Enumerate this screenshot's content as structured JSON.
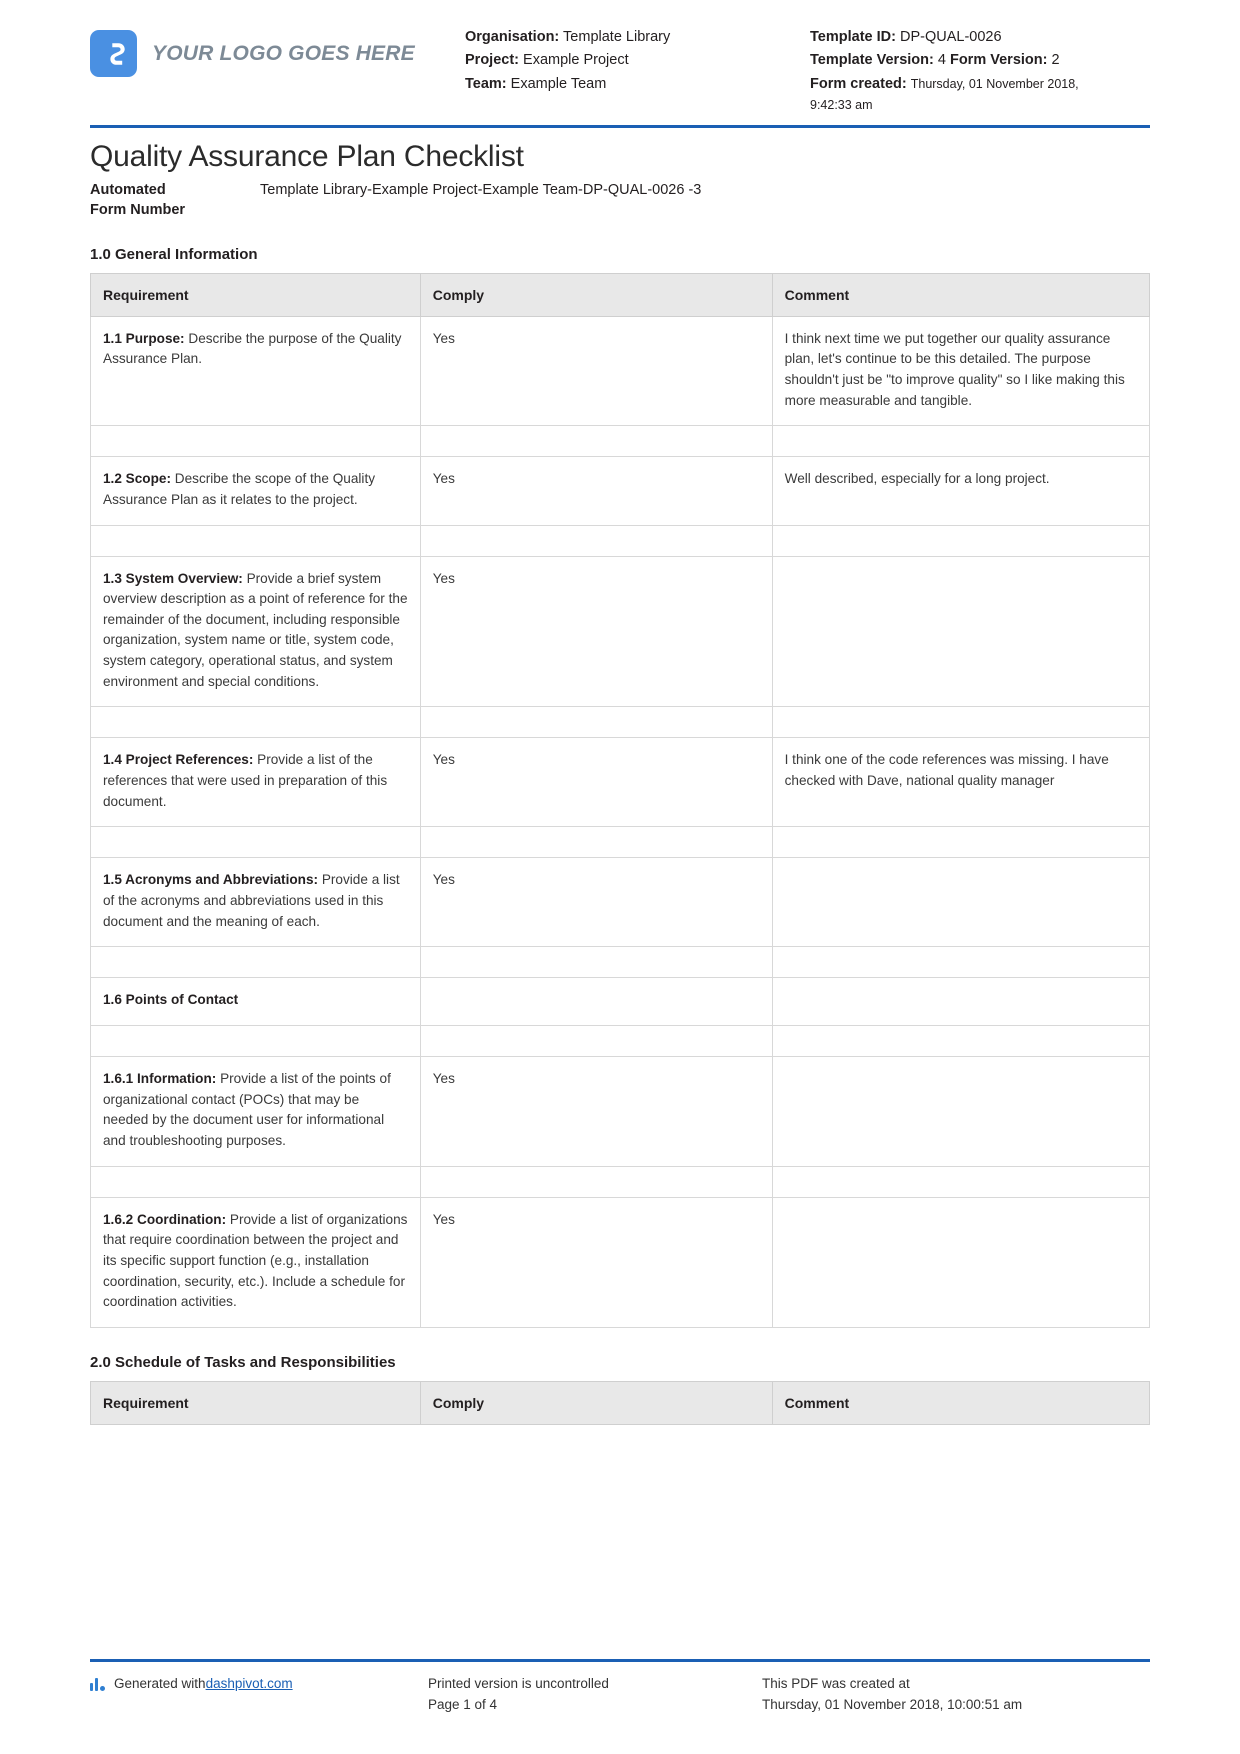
{
  "header": {
    "logo_text": "YOUR LOGO GOES HERE",
    "left_meta": [
      {
        "key": "Organisation:",
        "value": "Template Library"
      },
      {
        "key": "Project:",
        "value": "Example Project"
      },
      {
        "key": "Team:",
        "value": "Example Team"
      }
    ],
    "right_meta": {
      "template_id_key": "Template ID:",
      "template_id_value": "DP-QUAL-0026",
      "template_version_key": "Template Version:",
      "template_version_value": "4",
      "form_version_key": "Form Version:",
      "form_version_value": "2",
      "form_created_key": "Form created:",
      "form_created_value": "Thursday, 01 November 2018,",
      "form_created_time": "9:42:33 am"
    }
  },
  "title": "Quality Assurance Plan Checklist",
  "form_number": {
    "label_line1": "Automated",
    "label_line2": "Form Number",
    "value": "Template Library-Example Project-Example Team-DP-QUAL-0026   -3"
  },
  "sections": [
    {
      "heading": "1.0 General Information",
      "columns": [
        "Requirement",
        "Comply",
        "Comment"
      ],
      "rows": [
        {
          "lead": "1.1 Purpose:",
          "requirement": " Describe the purpose of the Quality Assurance Plan.",
          "comply": "Yes",
          "comment": "I think next time we put together our quality assurance plan, let's continue to be this detailed. The purpose shouldn't just be \"to improve quality\" so I like making this more measurable and tangible."
        },
        {
          "lead": "1.2 Scope:",
          "requirement": " Describe the scope of the Quality Assurance Plan as it relates to the project.",
          "comply": "Yes",
          "comment": "Well described, especially for a long project."
        },
        {
          "lead": "1.3 System Overview:",
          "requirement": " Provide a brief system overview description as a point of reference for the remainder of the document, including responsible organization, system name or title, system code, system category, operational status, and system environment and special conditions.",
          "comply": "Yes",
          "comment": ""
        },
        {
          "lead": "1.4 Project References:",
          "requirement": " Provide a list of the references that were used in preparation of this document.",
          "comply": "Yes",
          "comment": "I think one of the code references was missing. I have checked with Dave, national quality manager"
        },
        {
          "lead": "1.5 Acronyms and Abbreviations:",
          "requirement": " Provide a list of the acronyms and abbreviations used in this document and the meaning of each.",
          "comply": "Yes",
          "comment": ""
        },
        {
          "lead": "1.6 Points of Contact",
          "requirement": "",
          "comply": "",
          "comment": ""
        },
        {
          "lead": "1.6.1 Information:",
          "requirement": " Provide a list of the points of organizational contact (POCs) that may be needed by the document user for informational and troubleshooting purposes.",
          "comply": "Yes",
          "comment": ""
        },
        {
          "lead": "1.6.2 Coordination:",
          "requirement": " Provide a list of organizations that require coordination between the project and its specific support function (e.g., installation coordination, security, etc.). Include a schedule for coordination activities.",
          "comply": "Yes",
          "comment": ""
        }
      ]
    },
    {
      "heading": "2.0 Schedule of Tasks and Responsibilities",
      "columns": [
        "Requirement",
        "Comply",
        "Comment"
      ],
      "rows": []
    }
  ],
  "footer": {
    "generated_prefix": "Generated with ",
    "generated_link": "dashpivot.com",
    "uncontrolled": "Printed version is uncontrolled",
    "page": "Page 1 of 4",
    "created_at_label": "This PDF was created at",
    "created_at_value": "Thursday, 01 November 2018, 10:00:51 am"
  },
  "colors": {
    "accent_blue": "#1a5fb4",
    "logo_blue": "#4a90e2",
    "header_grey": "#e8e8e8"
  }
}
